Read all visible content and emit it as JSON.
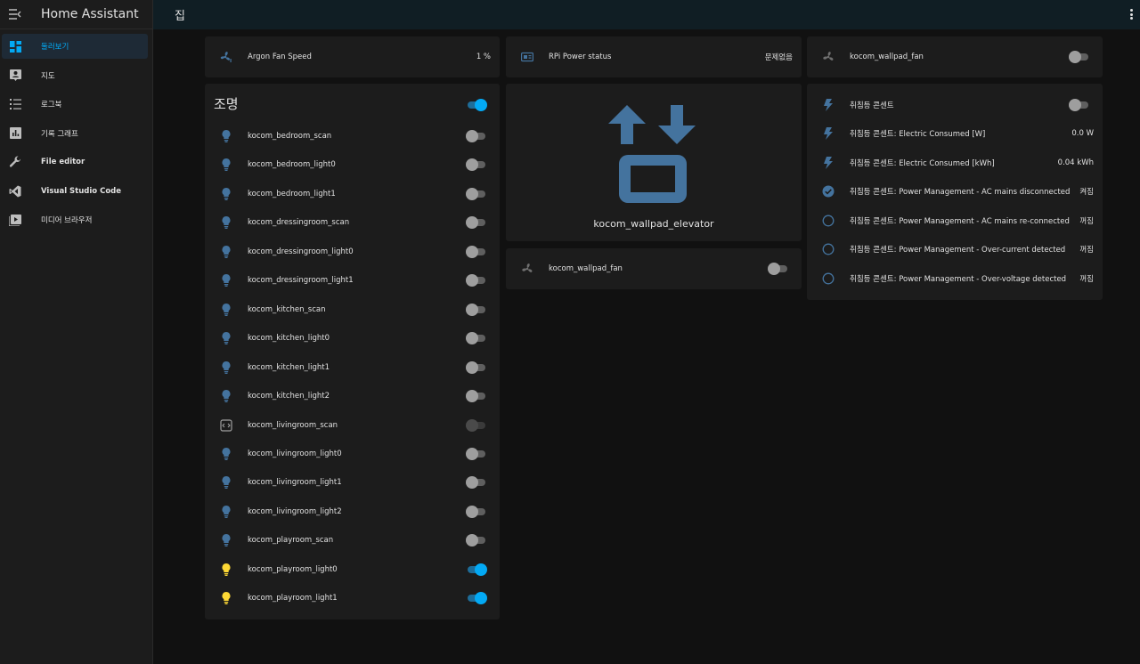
{
  "app": {
    "title": "Home Assistant"
  },
  "sidebar": {
    "items": [
      {
        "label": "둘러보기",
        "icon": "dashboard-icon",
        "active": true
      },
      {
        "label": "지도",
        "icon": "map-account-icon"
      },
      {
        "label": "로그북",
        "icon": "format-list-bulleted-icon"
      },
      {
        "label": "기록 그래프",
        "icon": "chart-box-icon"
      },
      {
        "label": "File editor",
        "icon": "wrench-icon"
      },
      {
        "label": "Visual Studio Code",
        "icon": "vscode-icon"
      },
      {
        "label": "미디어 브라우저",
        "icon": "play-box-icon"
      }
    ]
  },
  "topbar": {
    "title": "집"
  },
  "cards": {
    "fan_speed": {
      "name": "Argon Fan Speed",
      "value": "1 %"
    },
    "rpi_power": {
      "name": "RPi Power status",
      "value": "문제없음"
    },
    "wallpad_fan_top": {
      "name": "kocom_wallpad_fan",
      "state": "off"
    },
    "lights": {
      "title": "조명",
      "master_state": "on",
      "items": [
        {
          "name": "kocom_bedroom_scan",
          "state": "off"
        },
        {
          "name": "kocom_bedroom_light0",
          "state": "off"
        },
        {
          "name": "kocom_bedroom_light1",
          "state": "off"
        },
        {
          "name": "kocom_dressingroom_scan",
          "state": "off"
        },
        {
          "name": "kocom_dressingroom_light0",
          "state": "off"
        },
        {
          "name": "kocom_dressingroom_light1",
          "state": "off"
        },
        {
          "name": "kocom_kitchen_scan",
          "state": "off"
        },
        {
          "name": "kocom_kitchen_light0",
          "state": "off"
        },
        {
          "name": "kocom_kitchen_light1",
          "state": "off"
        },
        {
          "name": "kocom_kitchen_light2",
          "state": "off"
        },
        {
          "name": "kocom_livingroom_scan",
          "state": "unavailable"
        },
        {
          "name": "kocom_livingroom_light0",
          "state": "off"
        },
        {
          "name": "kocom_livingroom_light1",
          "state": "off"
        },
        {
          "name": "kocom_livingroom_light2",
          "state": "off"
        },
        {
          "name": "kocom_playroom_scan",
          "state": "off"
        },
        {
          "name": "kocom_playroom_light0",
          "state": "on"
        },
        {
          "name": "kocom_playroom_light1",
          "state": "on"
        }
      ]
    },
    "elevator": {
      "name": "kocom_wallpad_elevator"
    },
    "wallpad_fan_mid": {
      "name": "kocom_wallpad_fan",
      "state": "off"
    },
    "outlet": {
      "items": [
        {
          "name": "취침등 콘센트",
          "kind": "toggle",
          "state": "off"
        },
        {
          "name": "취침등 콘센트: Electric Consumed [W]",
          "kind": "sensor",
          "value": "0.0 W"
        },
        {
          "name": "취침등 콘센트: Electric Consumed [kWh]",
          "kind": "sensor",
          "value": "0.04 kWh"
        },
        {
          "name": "취침등 콘센트: Power Management - AC mains disconnected",
          "kind": "binary",
          "on": true,
          "value": "켜짐"
        },
        {
          "name": "취침등 콘센트: Power Management - AC mains re-connected",
          "kind": "binary",
          "on": false,
          "value": "꺼짐"
        },
        {
          "name": "취침등 콘센트: Power Management - Over-current detected",
          "kind": "binary",
          "on": false,
          "value": "꺼짐"
        },
        {
          "name": "취침등 콘센트: Power Management - Over-voltage detected",
          "kind": "binary",
          "on": false,
          "value": "꺼짐"
        }
      ]
    }
  },
  "colors": {
    "accent": "#03a9f4",
    "icon_blue": "#44739e",
    "bulb_on": "#fdd835"
  }
}
